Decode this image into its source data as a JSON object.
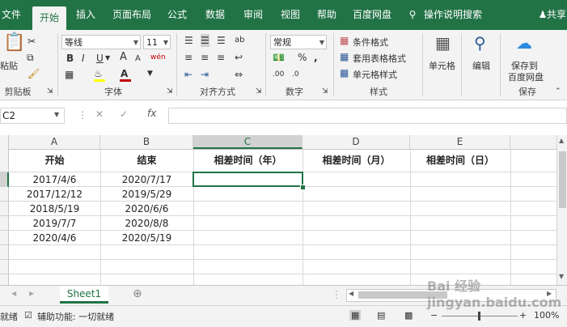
{
  "tabs": [
    "文件",
    "开始",
    "插入",
    "页面布局",
    "公式",
    "数据",
    "审阅",
    "视图",
    "帮助",
    "百度网盘",
    "操作说明搜索",
    "共享"
  ],
  "ribbon": {
    "clipboard": {
      "paste": "粘贴",
      "label": "剪贴板"
    },
    "font": {
      "name": "等线",
      "size": "11",
      "label": "字体",
      "bold": "B",
      "italic": "I",
      "underline": "U",
      "grow": "A",
      "shrink": "A",
      "wen": "wén"
    },
    "align": {
      "label": "对齐方式"
    },
    "number": {
      "format": "常规",
      "percent": "%",
      "comma": ",",
      "label": "数字",
      "inc": ".00",
      "dec": ".0"
    },
    "styles": {
      "cond": "条件格式",
      "table": "套用表格格式",
      "cell": "单元格样式",
      "label": "样式"
    },
    "cells": {
      "label": "单元格"
    },
    "edit": {
      "label": "编辑"
    },
    "save": {
      "line1": "保存到",
      "line2": "百度网盘",
      "label": "保存"
    }
  },
  "formula_bar": {
    "namebox": "C2",
    "fx": "fx",
    "value": ""
  },
  "columns": [
    "A",
    "B",
    "C",
    "D",
    "E"
  ],
  "rows": [
    [
      "开始",
      "结束",
      "相差时间（年）",
      "相差时间（月）",
      "相差时间（日）"
    ],
    [
      "2017/4/6",
      "2020/7/17",
      "",
      "",
      ""
    ],
    [
      "2017/12/12",
      "2019/5/29",
      "",
      "",
      ""
    ],
    [
      "2018/5/19",
      "2020/6/6",
      "",
      "",
      ""
    ],
    [
      "2019/7/7",
      "2020/8/8",
      "",
      "",
      ""
    ],
    [
      "2020/4/6",
      "2020/5/19",
      "",
      "",
      ""
    ]
  ],
  "sheet_tab": "Sheet1",
  "status": {
    "ready": "就绪",
    "accessibility": "辅助功能: 一切就绪",
    "zoom": "100%"
  },
  "watermark": "Bai 经验 jingyan.baidu.com",
  "colors": {
    "brand": "#217346",
    "accent": "#c00000"
  }
}
